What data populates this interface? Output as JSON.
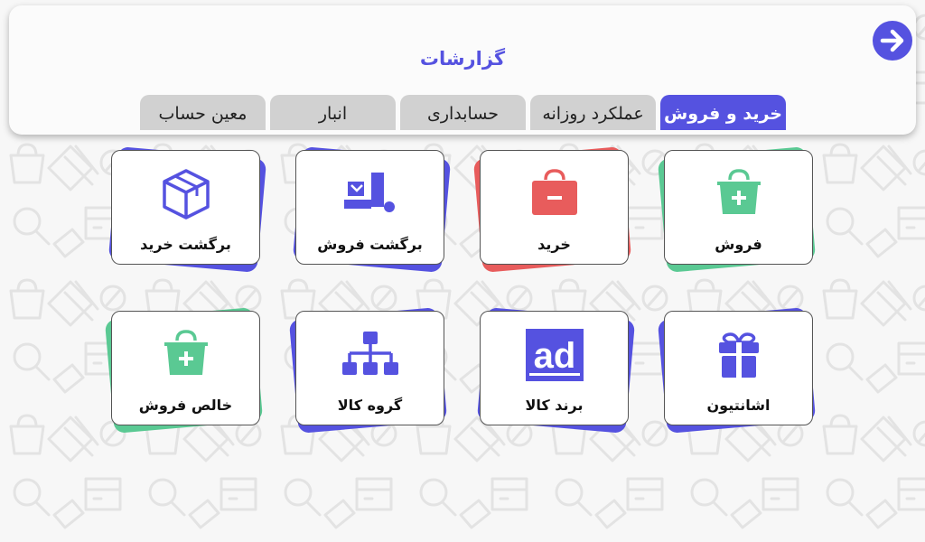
{
  "header": {
    "title": "گزارشات",
    "back_icon": "arrow-right-circle-icon"
  },
  "tabs": [
    {
      "label": "خرید و فروش",
      "active": true
    },
    {
      "label": "عملکرد روزانه",
      "active": false
    },
    {
      "label": "حسابداری",
      "active": false
    },
    {
      "label": "انبار",
      "active": false
    },
    {
      "label": "معین حساب",
      "active": false
    }
  ],
  "tiles": [
    {
      "label": "فروش",
      "icon": "shopping-bag-plus-icon",
      "icon_color": "#5ac993",
      "accent": "#5ac993"
    },
    {
      "label": "خرید",
      "icon": "shopping-bag-minus-icon",
      "icon_color": "#e85c5c",
      "accent": "#e85c5c"
    },
    {
      "label": "برگشت فروش",
      "icon": "hand-truck-return-icon",
      "icon_color": "#5552e0",
      "accent": "#5552e0"
    },
    {
      "label": "برگشت خرید",
      "icon": "box-icon",
      "icon_color": "#5552e0",
      "accent": "#5552e0"
    },
    {
      "label": "اشانتیون",
      "icon": "gift-icon",
      "icon_color": "#5552e0",
      "accent": "#5552e0"
    },
    {
      "label": "برند کالا",
      "icon": "ad-icon",
      "icon_color": "#5552e0",
      "accent": "#5552e0"
    },
    {
      "label": "گروه کالا",
      "icon": "sitemap-icon",
      "icon_color": "#5552e0",
      "accent": "#5552e0"
    },
    {
      "label": "خالص فروش",
      "icon": "shopping-bag-plus-icon",
      "icon_color": "#5ac993",
      "accent": "#5ac993"
    }
  ],
  "colors": {
    "primary": "#5552e0",
    "green": "#5ac993",
    "red": "#e85c5c",
    "tab_inactive": "#d1d1d1"
  }
}
